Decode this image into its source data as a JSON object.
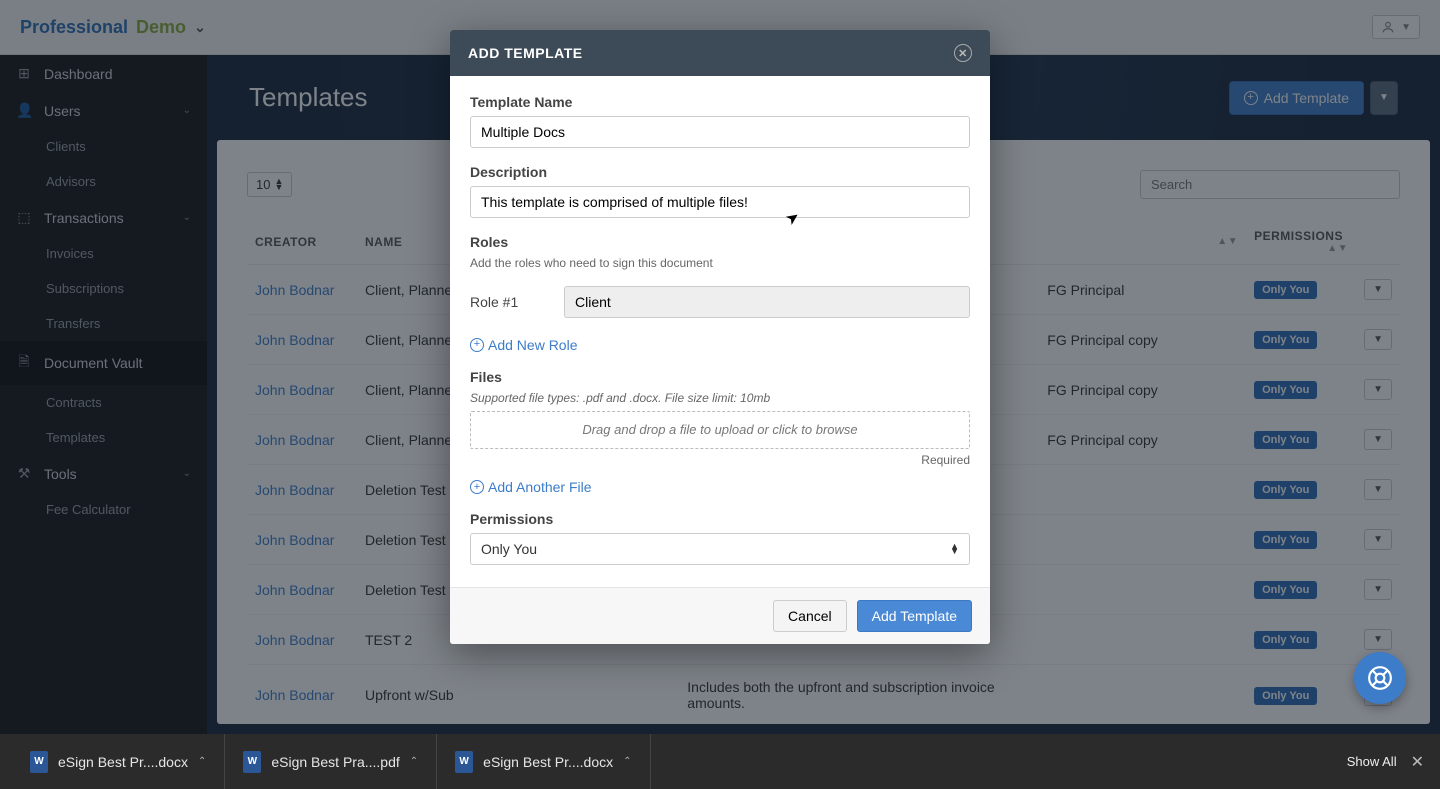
{
  "brand": {
    "prof": "Professional",
    "demo": "Demo"
  },
  "sidebar": {
    "items": [
      {
        "label": "Dashboard",
        "icon": "grid"
      },
      {
        "label": "Users",
        "icon": "users",
        "expand": true,
        "children": [
          {
            "label": "Clients"
          },
          {
            "label": "Advisors"
          }
        ]
      },
      {
        "label": "Transactions",
        "icon": "cash",
        "expand": true,
        "children": [
          {
            "label": "Invoices"
          },
          {
            "label": "Subscriptions"
          },
          {
            "label": "Transfers"
          }
        ]
      },
      {
        "label": "Document Vault",
        "icon": "doc",
        "expand": false,
        "children": [
          {
            "label": "Contracts"
          },
          {
            "label": "Templates"
          }
        ]
      },
      {
        "label": "Tools",
        "icon": "tool",
        "expand": true,
        "children": [
          {
            "label": "Fee Calculator"
          }
        ]
      }
    ]
  },
  "page": {
    "title": "Templates",
    "add_btn": "Add Template",
    "page_size": "10",
    "search_placeholder": "Search"
  },
  "table": {
    "headers": {
      "creator": "CREATOR",
      "name": "NAME",
      "permissions": "PERMISSIONS"
    },
    "rows": [
      {
        "creator": "John Bodnar",
        "name": "Client, Planne",
        "right": "FG Principal",
        "perm": "Only You"
      },
      {
        "creator": "John Bodnar",
        "name": "Client, Planne",
        "right": "FG Principal copy",
        "perm": "Only You"
      },
      {
        "creator": "John Bodnar",
        "name": "Client, Planne",
        "right": "FG Principal copy",
        "perm": "Only You"
      },
      {
        "creator": "John Bodnar",
        "name": "Client, Planne",
        "right": "FG Principal copy",
        "perm": "Only You"
      },
      {
        "creator": "John Bodnar",
        "name": "Deletion Test",
        "right": "",
        "perm": "Only You"
      },
      {
        "creator": "John Bodnar",
        "name": "Deletion Test",
        "right": "",
        "perm": "Only You"
      },
      {
        "creator": "John Bodnar",
        "name": "Deletion Test",
        "right": "",
        "perm": "Only You"
      },
      {
        "creator": "John Bodnar",
        "name": "TEST 2",
        "right": "",
        "perm": "Only You"
      },
      {
        "creator": "John Bodnar",
        "name": "Upfront w/Sub",
        "desc": "Includes both the upfront and subscription invoice amounts.",
        "right": "",
        "perm": "Only You"
      }
    ]
  },
  "modal": {
    "title": "ADD TEMPLATE",
    "template_name_label": "Template Name",
    "template_name_value": "Multiple Docs",
    "description_label": "Description",
    "description_value": "This template is comprised of multiple files!",
    "roles_label": "Roles",
    "roles_sub": "Add the roles who need to sign this document",
    "role1_label": "Role #1",
    "role1_value": "Client",
    "add_role": "Add New Role",
    "files_label": "Files",
    "files_sub": "Supported file types: .pdf and .docx. File size limit: 10mb",
    "dropzone": "Drag and drop a file to upload or click to browse",
    "required": "Required",
    "add_file": "Add Another File",
    "permissions_label": "Permissions",
    "permissions_value": "Only You",
    "cancel": "Cancel",
    "submit": "Add Template"
  },
  "downloads": {
    "items": [
      {
        "name": "eSign Best Pr....docx"
      },
      {
        "name": "eSign Best Pra....pdf"
      },
      {
        "name": "eSign Best Pr....docx"
      }
    ],
    "show_all": "Show All"
  }
}
